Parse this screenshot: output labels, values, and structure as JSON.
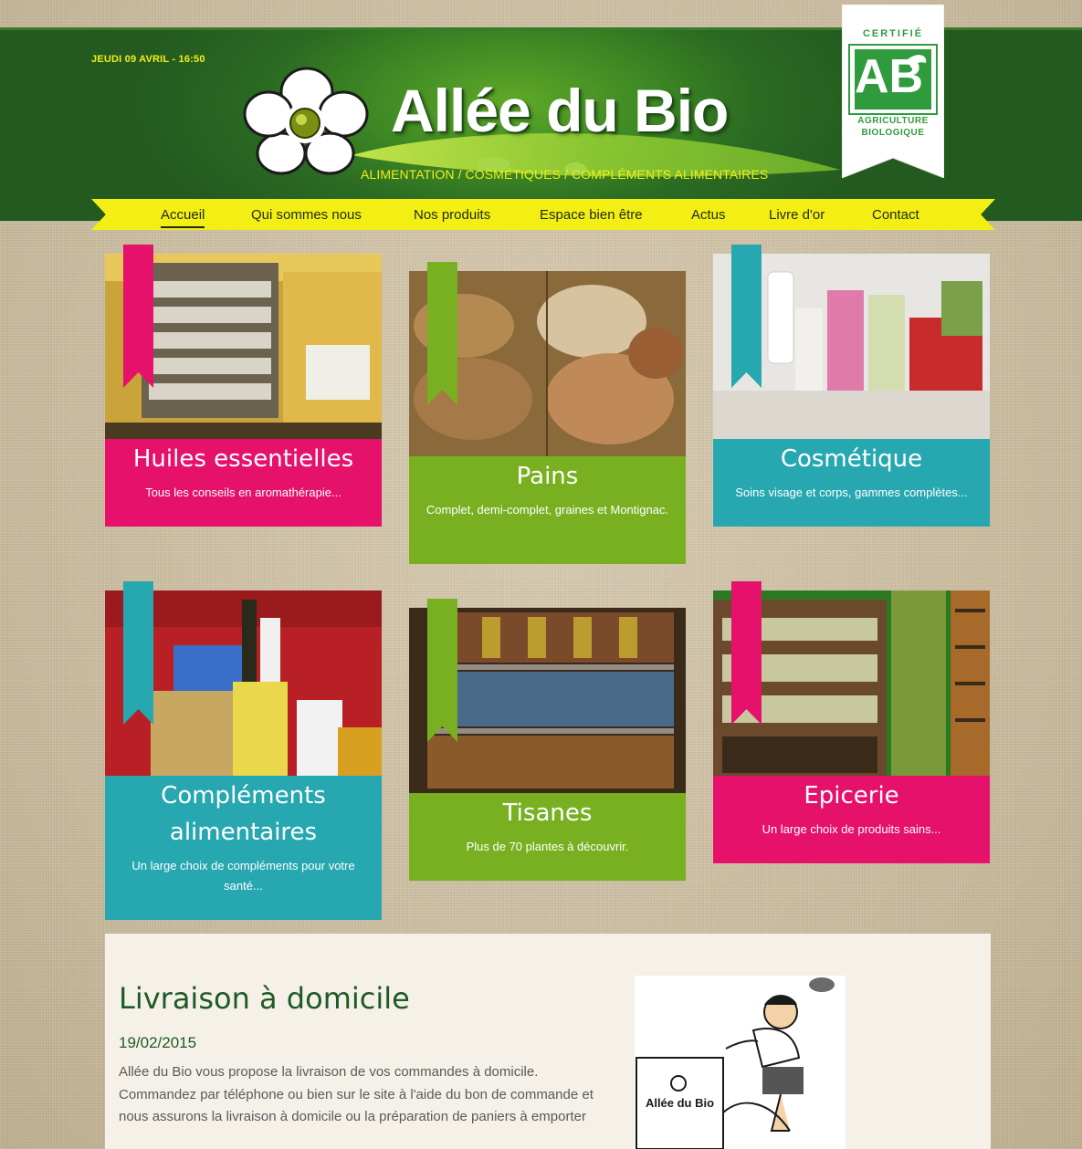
{
  "header": {
    "date": "JEUDI 09 AVRIL - 16:50",
    "site_title": "Allée du Bio",
    "tagline": "ALIMENTATION  / COSMÉTIQUES / COMPLÉMENTS ALIMENTAIRES",
    "badge": {
      "top_text": "CERTIFIÉ",
      "letters": "AB",
      "line1": "AGRICULTURE",
      "line2": "BIOLOGIQUE"
    }
  },
  "nav": {
    "items": [
      {
        "label": "Accueil",
        "active": true
      },
      {
        "label": "Qui sommes nous"
      },
      {
        "label": "Nos produits"
      },
      {
        "label": "Espace bien être"
      },
      {
        "label": "Actus"
      },
      {
        "label": "Livre d'or"
      },
      {
        "label": "Contact"
      }
    ]
  },
  "cards": [
    {
      "title": "Huiles essentielles",
      "desc": "Tous les conseils en aromathérapie...",
      "color": "#e5116a",
      "ribbon": "#e5116a"
    },
    {
      "title": "Pains",
      "desc": "Complet, demi-complet, graines et Montignac.",
      "color": "#79b021",
      "ribbon": "#79b021"
    },
    {
      "title": "Cosmétique",
      "desc": "Soins visage et corps, gammes complètes...",
      "color": "#27a8b0",
      "ribbon": "#27a8b0"
    },
    {
      "title": "Compléments alimentaires",
      "desc": "Un large choix de compléments pour votre santé...",
      "color": "#27a8b0",
      "ribbon": "#27a8b0"
    },
    {
      "title": "Tisanes",
      "desc": "Plus de 70 plantes à découvrir.",
      "color": "#79b021",
      "ribbon": "#79b021"
    },
    {
      "title": "Epicerie",
      "desc": "Un large choix de produits sains...",
      "color": "#e5116a",
      "ribbon": "#e5116a"
    }
  ],
  "news": {
    "title": "Livraison à domicile",
    "date": "19/02/2015",
    "body": "Allée du Bio vous propose la livraison de vos commandes à domicile. Commandez par téléphone ou bien sur le site à l'aide du bon de commande et nous assurons la livraison à domicile ou la préparation de paniers à emporter",
    "image_label": "Allée du Bio"
  },
  "colors": {
    "header_green": "#2a6a22",
    "nav_yellow": "#f3ef14",
    "pink": "#e5116a",
    "green": "#79b021",
    "teal": "#27a8b0",
    "news_title": "#1e5a24"
  }
}
